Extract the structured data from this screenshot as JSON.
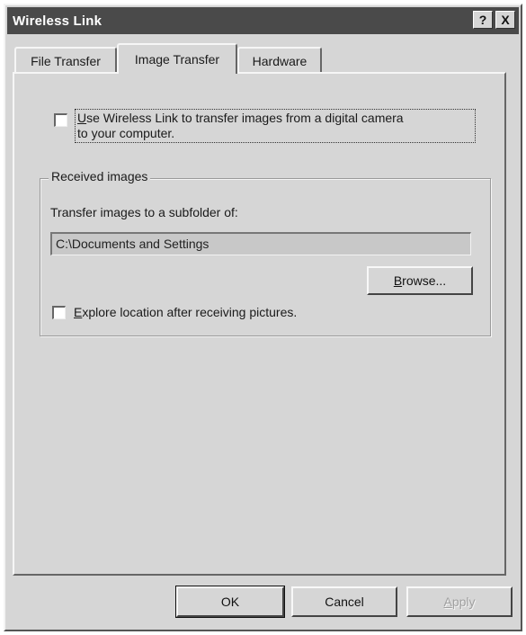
{
  "window": {
    "title": "Wireless Link",
    "help_button": "?",
    "close_button": "X"
  },
  "tabs": [
    {
      "label": "File Transfer",
      "active": false
    },
    {
      "label": "Image Transfer",
      "active": true
    },
    {
      "label": "Hardware",
      "active": false
    }
  ],
  "image_transfer": {
    "use_checkbox": {
      "checked": false,
      "line1_mnemonic": "U",
      "line1_rest": "se  Wireless Link to transfer images from a digital camera",
      "line2": "to your computer."
    },
    "group_title": "Received images",
    "transfer_label": "Transfer images to a subfolder of:",
    "path_value": "C:\\Documents and Settings",
    "browse_button": {
      "mnemonic": "B",
      "rest": "rowse..."
    },
    "explore_checkbox": {
      "checked": false,
      "mnemonic": "E",
      "rest": "xplore location after receiving pictures."
    }
  },
  "footer": {
    "ok_label": "OK",
    "cancel_label": "Cancel",
    "apply_mnemonic": "A",
    "apply_rest": "pply"
  }
}
